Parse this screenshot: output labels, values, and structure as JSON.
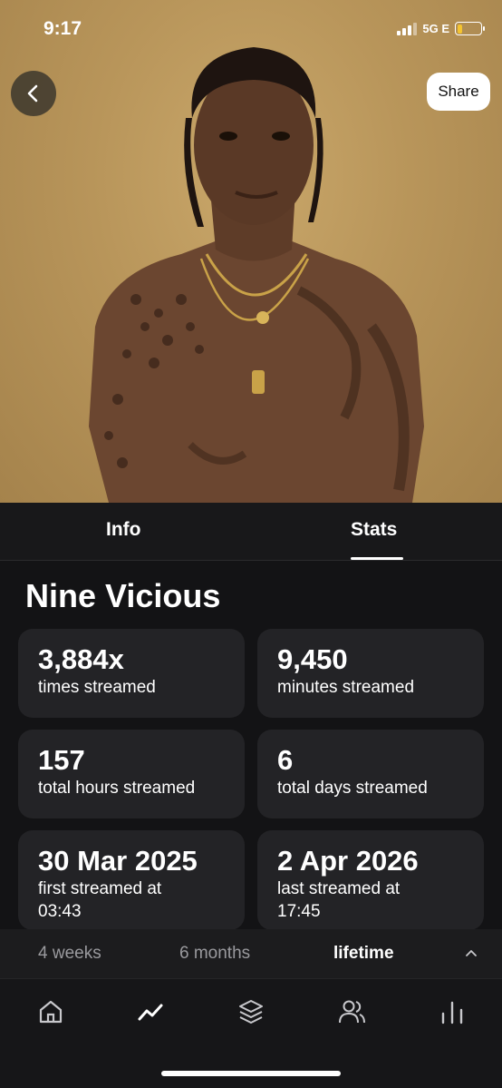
{
  "status_bar": {
    "time": "9:17",
    "network": "5G E"
  },
  "header": {
    "share_label": "Share"
  },
  "tabs": [
    {
      "label": "Info"
    },
    {
      "label": "Stats"
    }
  ],
  "artist": {
    "name": "Nine Vicious"
  },
  "stats": [
    {
      "value": "3,884x",
      "label": "times streamed"
    },
    {
      "value": "9,450",
      "label": "minutes streamed"
    },
    {
      "value": "157",
      "label": "total hours streamed"
    },
    {
      "value": "6",
      "label": "total days streamed"
    },
    {
      "value": "30 Mar 2025",
      "label": "first streamed at",
      "sub": "03:43"
    },
    {
      "value": "2 Apr 2026",
      "label": "last streamed at",
      "sub": "17:45"
    }
  ],
  "periods": [
    {
      "label": "4 weeks"
    },
    {
      "label": "6 months"
    },
    {
      "label": "lifetime"
    }
  ],
  "selected_period": "lifetime",
  "selected_tab": "Stats",
  "nav_icons": [
    "home-icon",
    "trending-icon",
    "layers-icon",
    "users-icon",
    "bar-chart-icon"
  ],
  "colors": {
    "background": "#131315",
    "card": "#232326",
    "battery": "#f4c430"
  }
}
